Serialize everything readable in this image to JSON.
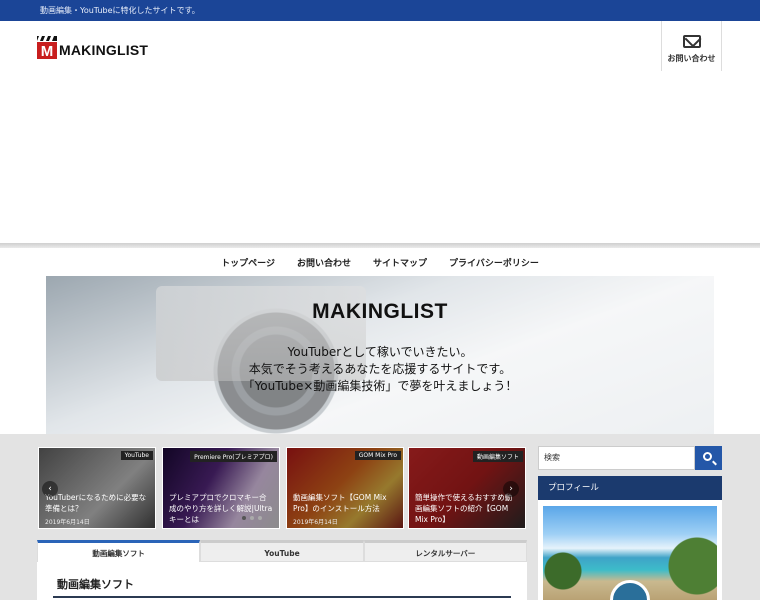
{
  "topbar": {
    "tagline": "動画編集・YouTubeに特化したサイトです。"
  },
  "header": {
    "logo_text": "MAKINGLIST",
    "contact_label": "お問い合わせ"
  },
  "nav": {
    "items": [
      "トップページ",
      "お問い合わせ",
      "サイトマップ",
      "プライバシーポリシー"
    ]
  },
  "hero": {
    "title": "MAKINGLIST",
    "lines": [
      "YouTuberとして稼いでいきたい。",
      "本気でそう考えるあなたを応援するサイトです。",
      "「YouTube×動画編集技術」で夢を叶えましょう！"
    ]
  },
  "cards": [
    {
      "tag": "YouTube",
      "title": "YouTuberになるために必要な準備とは？",
      "date": "2019年6月14日"
    },
    {
      "tag": "Premiere Pro(プレミアプロ)",
      "title": "プレミアプロでクロマキー合成のやり方を詳しく解説|Ultraキーとは",
      "date": ""
    },
    {
      "tag": "GOM Mix Pro",
      "title": "動画編集ソフト【GOM Mix Pro】のインストール方法",
      "date": "2019年6月14日"
    },
    {
      "tag": "動画編集ソフト",
      "title": "簡単操作で使えるおすすめ動画編集ソフトの紹介【GOM Mix Pro】",
      "date": ""
    }
  ],
  "tabs": {
    "items": [
      "動画編集ソフト",
      "YouTube",
      "レンタルサーバー"
    ],
    "active_title": "動画編集ソフト"
  },
  "sidebar": {
    "search_placeholder": "検索",
    "profile_heading": "プロフィール"
  },
  "colors": {
    "topbar": "#1b4597",
    "accent": "#2457a8",
    "profile_head": "#1b3a6e"
  }
}
